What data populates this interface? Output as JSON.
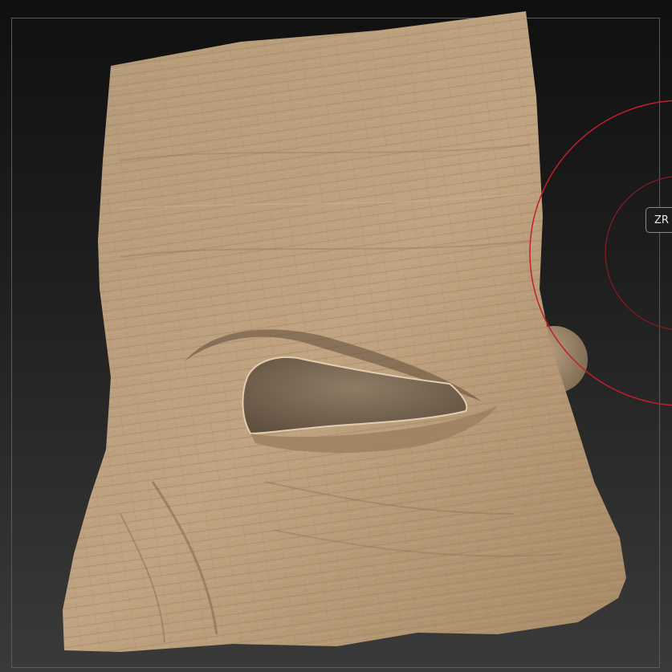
{
  "app": {
    "brush_hint_label": "ZR"
  },
  "colors": {
    "sculpt_clay": "#b39773",
    "clay_shadow": "#6e5a42",
    "brush_ring": "#c2202a",
    "background_top": "#101010",
    "background_bottom": "#3a3a3a"
  },
  "icons": {
    "brush_cursor": "brush-radius-ring-icon"
  }
}
